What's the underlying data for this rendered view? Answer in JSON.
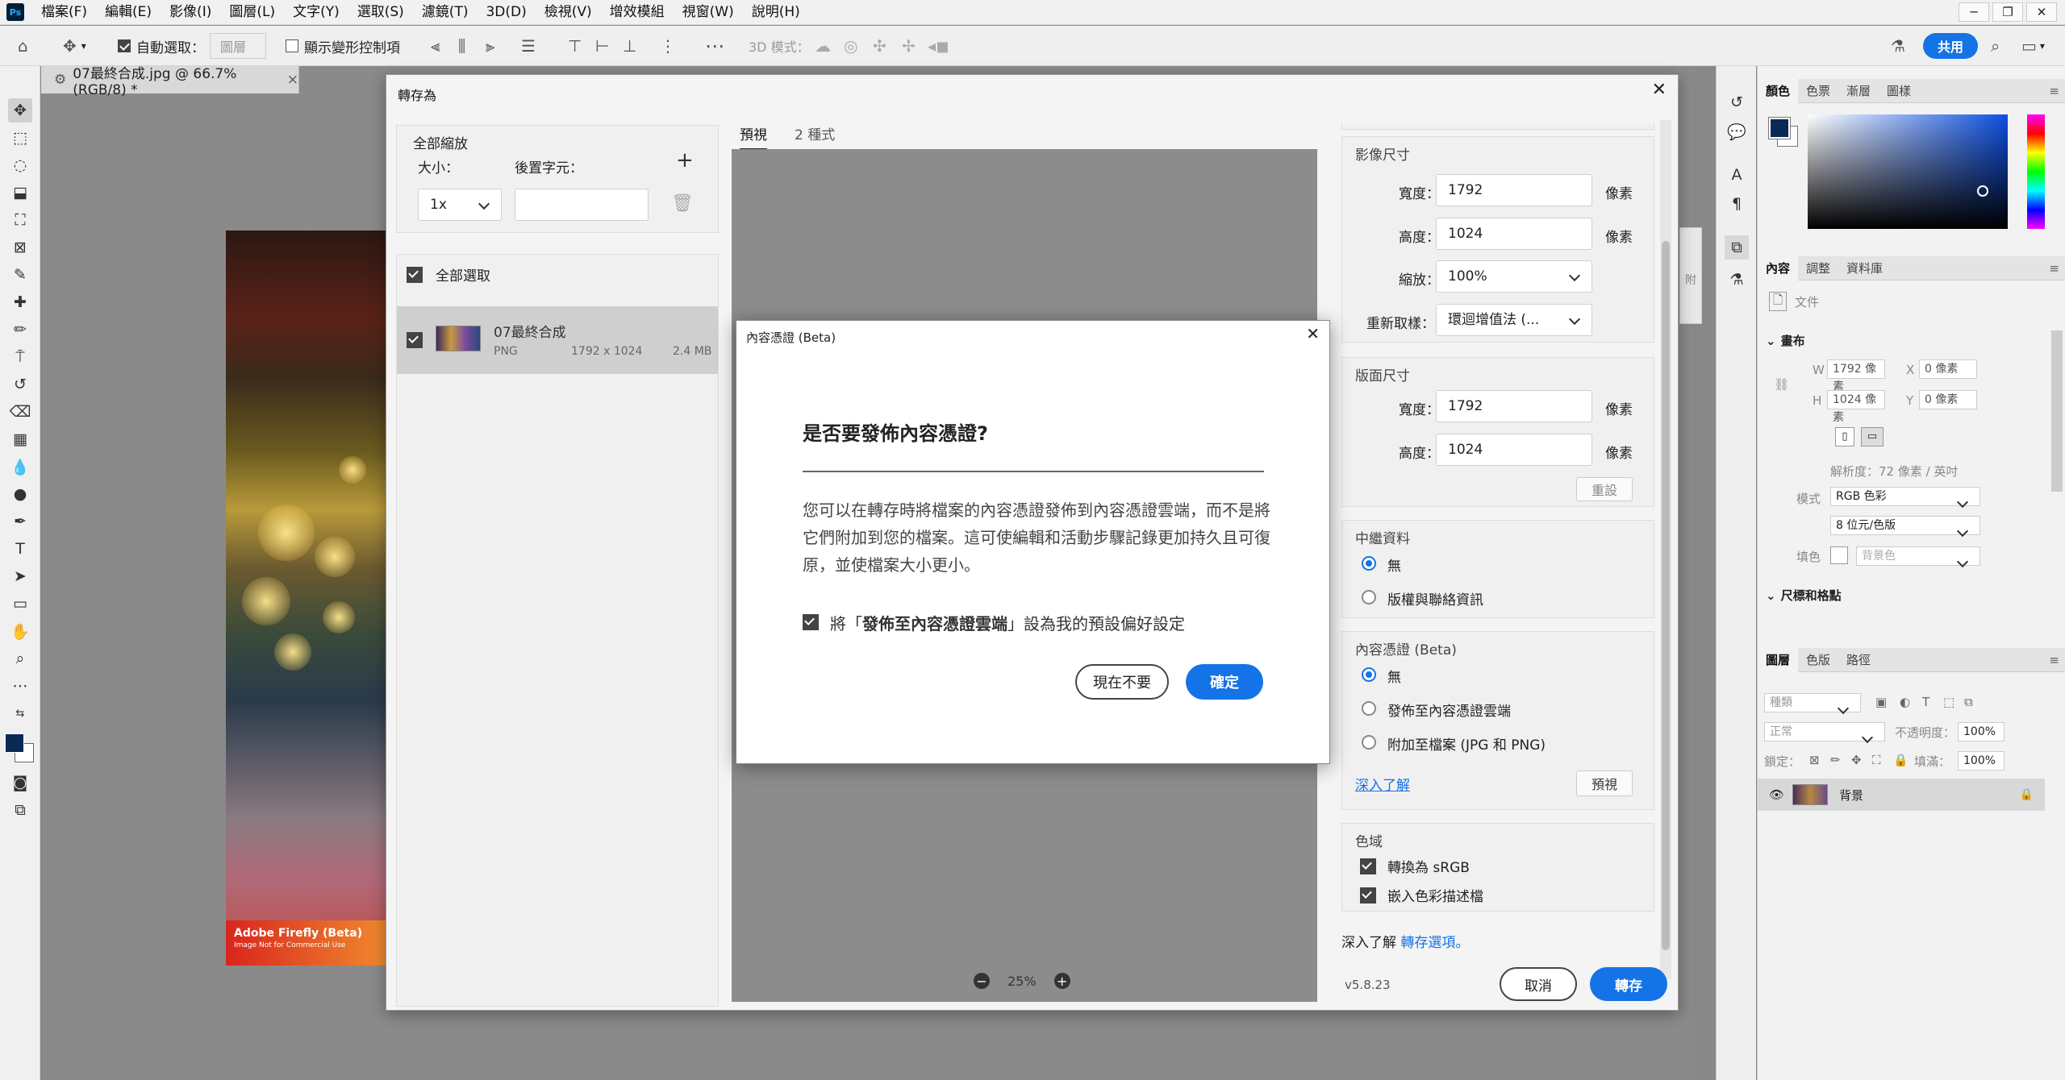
{
  "menubar": {
    "logo": "Ps",
    "items": [
      "檔案(F)",
      "編輯(E)",
      "影像(I)",
      "圖層(L)",
      "文字(Y)",
      "選取(S)",
      "濾鏡(T)",
      "3D(D)",
      "檢視(V)",
      "增效模組",
      "視窗(W)",
      "說明(H)"
    ],
    "win_min": "─",
    "win_restore": "❐",
    "win_close": "✕"
  },
  "optbar": {
    "auto_select_label": "自動選取：",
    "auto_select_value": "圖層",
    "show_transform_label": "顯示變形控制項",
    "mode_3d_label": "3D 模式：",
    "share_label": "共用"
  },
  "document": {
    "tab_title": "07最終合成.jpg @ 66.7% (RGB/8) *",
    "firefly_brand": "Adobe Firefly (Beta)",
    "firefly_note": "Image Not for Commercial Use"
  },
  "right_panels": {
    "color_tabs": [
      "顏色",
      "色票",
      "漸層",
      "圖樣"
    ],
    "props_tabs": [
      "內容",
      "調整",
      "資料庫"
    ],
    "doc_label": "文件",
    "canvas_header": "畫布",
    "w_label": "W",
    "w_value": "1792 像素",
    "h_label": "H",
    "h_value": "1024 像素",
    "x_label": "X",
    "x_value": "0 像素",
    "y_label": "Y",
    "y_value": "0 像素",
    "resolution": "解析度：72 像素 / 英吋",
    "mode_label": "模式",
    "mode_value": "RGB 色彩",
    "depth_value": "8 位元/色版",
    "fill_label": "填色",
    "fill_value": "背景色",
    "rulers_header": "尺標和格點",
    "layers_tabs": [
      "圖層",
      "色版",
      "路徑"
    ],
    "kind_placeholder": "種類",
    "blend_mode": "正常",
    "opacity_label": "不透明度：",
    "opacity_value": "100%",
    "lock_label": "鎖定：",
    "fill_pct_label": "填滿：",
    "fill_pct_value": "100%",
    "layer_name": "背景",
    "side_attach": "附"
  },
  "export": {
    "title": "轉存為",
    "scale_all": "全部縮放",
    "size_label": "大小：",
    "suffix_label": "後置字元：",
    "size_value": "1x",
    "select_all": "全部選取",
    "file_name": "07最終合成",
    "file_format": "PNG",
    "file_dims": "1792 x 1024",
    "file_size": "2.4 MB",
    "tab_preview": "預視",
    "tab_sizes": "2 種式",
    "zoom_value": "25%",
    "image_size_header": "影像尺寸",
    "width_label": "寬度：",
    "width_value": "1792",
    "height_label": "高度：",
    "height_value": "1024",
    "unit_px": "像素",
    "scale_label": "縮放：",
    "scale_value": "100%",
    "resample_label": "重新取樣：",
    "resample_value": "環迴增值法 (...",
    "canvas_size_header": "版面尺寸",
    "canvas_width_value": "1792",
    "canvas_height_value": "1024",
    "reset_label": "重設",
    "metadata_header": "中繼資料",
    "meta_none": "無",
    "meta_copyright": "版權與聯絡資訊",
    "cred_header": "內容憑證 (Beta)",
    "cred_none": "無",
    "cred_publish": "發佈至內容憑證雲端",
    "cred_attach": "附加至檔案 (JPG 和 PNG)",
    "learn_more": "深入了解",
    "preview_btn": "預視",
    "colorspace_header": "色域",
    "convert_srgb": "轉換為 sRGB",
    "embed_profile": "嵌入色彩描述檔",
    "learn_more_prefix": "深入了解",
    "export_options_link": "轉存選項。",
    "version": "v5.8.23",
    "cancel": "取消",
    "export_btn": "轉存"
  },
  "cred_dialog": {
    "title": "內容憑證 (Beta)",
    "heading": "是否要發佈內容憑證?",
    "body": "您可以在轉存時將檔案的內容憑證發佈到內容憑證雲端，而不是將它們附加到您的檔案。這可使編輯和活動步驟記錄更加持久且可復原，並使檔案大小更小。",
    "pref_prefix": "將「",
    "pref_bold": "發佈至內容憑證雲端",
    "pref_suffix": "」設為我的預設偏好設定",
    "not_now": "現在不要",
    "ok": "確定"
  },
  "colors": {
    "accent": "#1473e6",
    "ps_blue": "#31a8ff",
    "fg_swatch": "#0a2a55"
  }
}
